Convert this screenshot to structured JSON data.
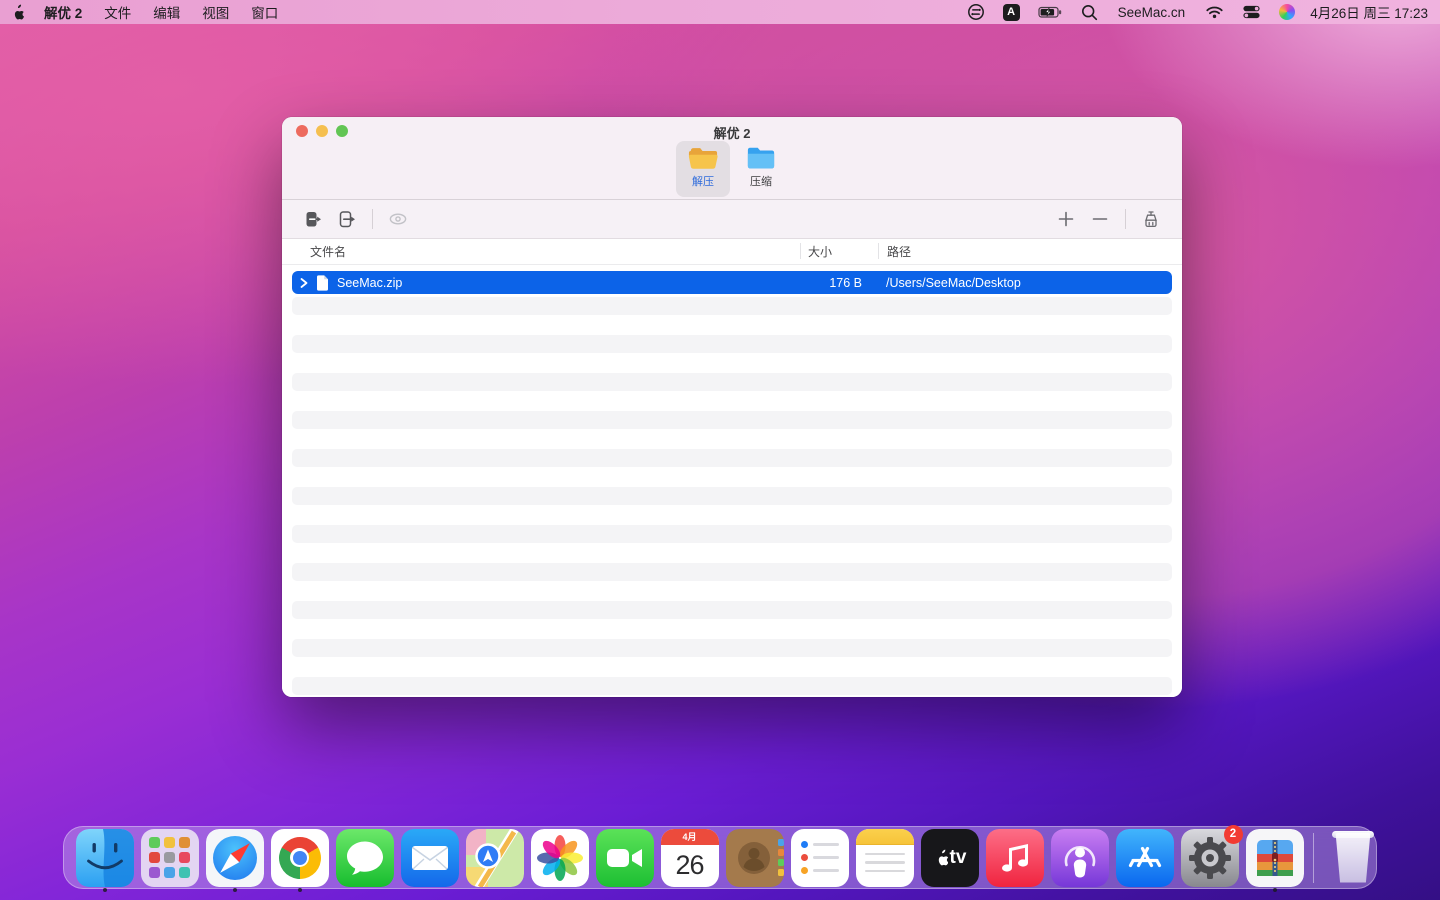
{
  "menubar": {
    "app_menu": "解优 2",
    "menus": [
      "文件",
      "编辑",
      "视图",
      "窗口"
    ],
    "status": {
      "input_badge": "A",
      "site_label": "SeeMac.cn",
      "clock": "4月26日 周三 17:23"
    },
    "icons": [
      "apple-logo-icon",
      "switch-app-icon",
      "input-source-icon",
      "battery-charging-icon",
      "spotlight-search-icon",
      "wifi-icon",
      "control-center-icon",
      "siri-icon"
    ]
  },
  "window": {
    "title": "解优 2",
    "tabs": {
      "extract": "解压",
      "compress": "压缩"
    },
    "toolbar_icons": [
      "import-file-icon",
      "export-file-icon",
      "preview-eye-icon",
      "add-icon",
      "remove-icon",
      "clean-list-icon"
    ],
    "table": {
      "columns": [
        "文件名",
        "大小",
        "路径"
      ],
      "rows": [
        {
          "name": "SeeMac.zip",
          "size": "176 B",
          "path": "/Users/SeeMac/Desktop",
          "selected": true
        }
      ]
    }
  },
  "dock": {
    "apps": [
      "finder",
      "launchpad",
      "safari",
      "chrome",
      "messages",
      "mail",
      "maps",
      "photos",
      "facetime",
      "calendar",
      "contacts",
      "reminders",
      "notes",
      "apple-tv",
      "music",
      "podcasts",
      "app-store",
      "system-settings",
      "archiver",
      "trash"
    ],
    "running": [
      "finder",
      "safari",
      "chrome",
      "archiver"
    ],
    "calendar": {
      "month": "4月",
      "day": "26"
    },
    "appletv_label": "tv",
    "settings_badge": "2"
  },
  "colors": {
    "selection_blue": "#0c63e8",
    "tab_label_blue": "#2e6bdb",
    "stripe_gray": "#f4f4f6",
    "menubar_pink": "#ecaad9",
    "traffic_red": "#ed6a5e",
    "traffic_yellow": "#f5bf4f",
    "traffic_green": "#62c554"
  }
}
